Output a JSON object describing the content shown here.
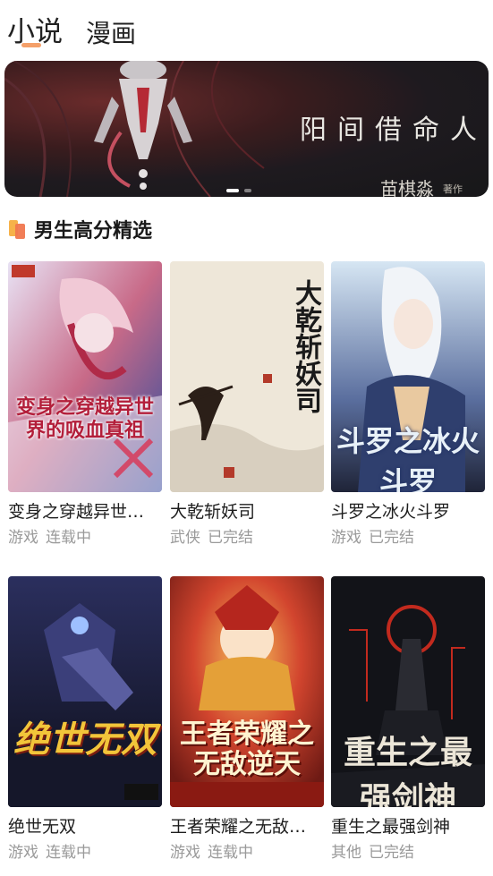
{
  "tabs": [
    {
      "label": "小说",
      "active": true
    },
    {
      "label": "漫画",
      "active": false
    }
  ],
  "banner": {
    "title": "阳间借命人",
    "author": "苗棋淼",
    "author_suffix": "著作",
    "dots": 2,
    "active_dot": 0
  },
  "section": {
    "title": "男生高分精选"
  },
  "books": [
    {
      "title": "变身之穿越异世…",
      "category": "游戏",
      "status": "连载中",
      "cover_text": "变身之穿越异世界的吸血真祖",
      "cover_colors": [
        "#e9e4f3",
        "#b93a57",
        "#2b4a9a"
      ]
    },
    {
      "title": "大乾斩妖司",
      "category": "武侠",
      "status": "已完结",
      "cover_text": "大乾斩妖司",
      "cover_colors": [
        "#efe9dc",
        "#3b2a1f",
        "#b33a2a"
      ]
    },
    {
      "title": "斗罗之冰火斗罗",
      "category": "游戏",
      "status": "已完结",
      "cover_text": "斗罗之冰火斗罗",
      "cover_colors": [
        "#cfe0f0",
        "#2f3f6e",
        "#1f2438"
      ]
    },
    {
      "title": "绝世无双",
      "category": "游戏",
      "status": "连载中",
      "cover_text": "绝世无双",
      "cover_colors": [
        "#1e2240",
        "#3b3f7a",
        "#e9c23a"
      ]
    },
    {
      "title": "王者荣耀之无敌…",
      "category": "游戏",
      "status": "连载中",
      "cover_text": "王者荣耀之无敌逆天",
      "cover_colors": [
        "#c0382b",
        "#f5a23a",
        "#7a1d16"
      ]
    },
    {
      "title": "重生之最强剑神",
      "category": "其他",
      "status": "已完结",
      "cover_text": "重生之最强剑神",
      "cover_colors": [
        "#0f1014",
        "#b3271e",
        "#e9e4d8"
      ]
    }
  ]
}
